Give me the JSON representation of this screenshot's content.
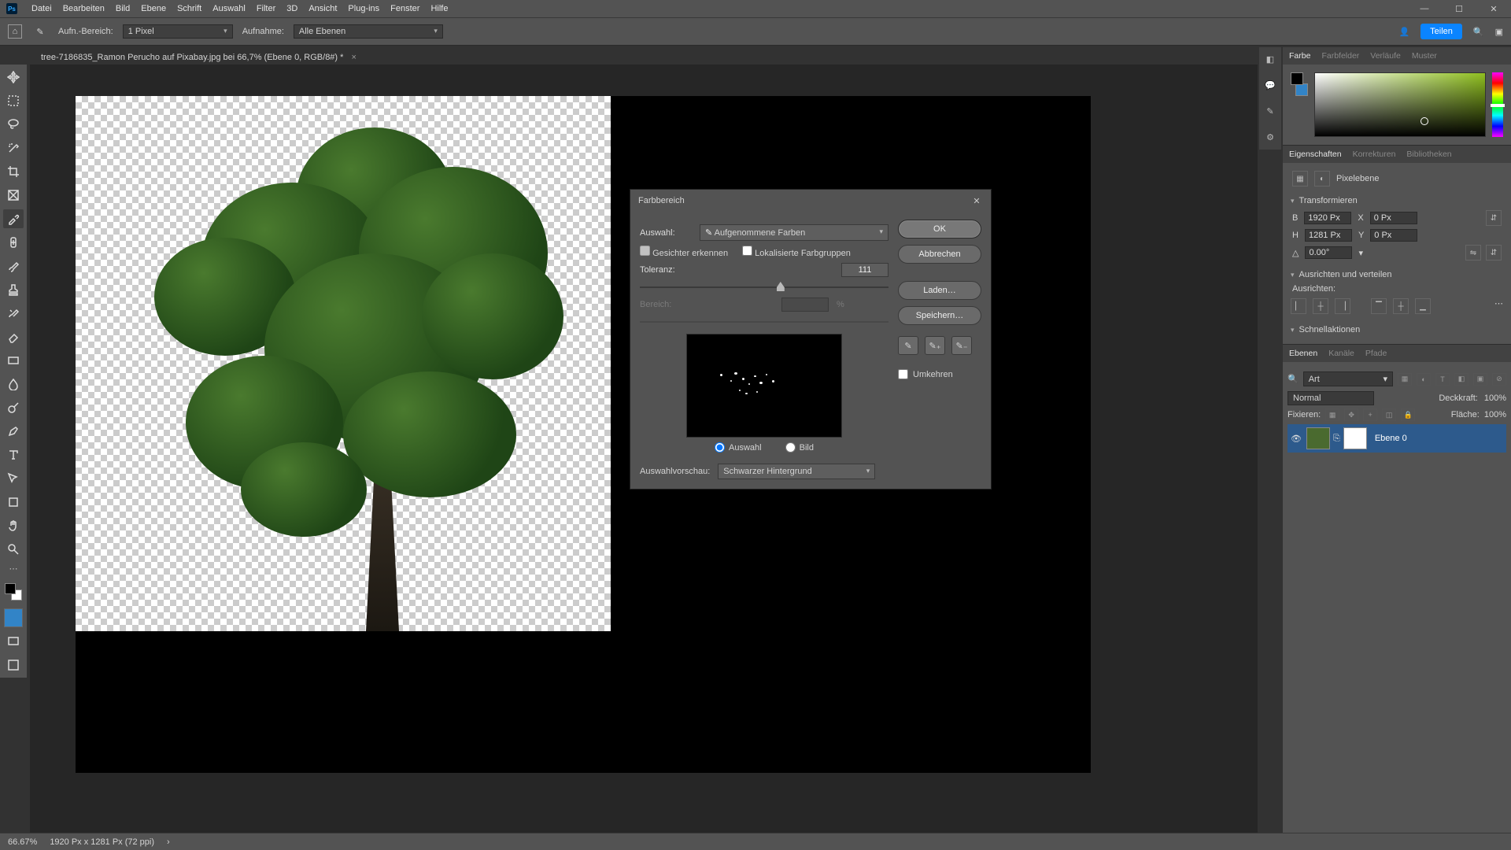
{
  "menu": {
    "items": [
      "Datei",
      "Bearbeiten",
      "Bild",
      "Ebene",
      "Schrift",
      "Auswahl",
      "Filter",
      "3D",
      "Ansicht",
      "Plug-ins",
      "Fenster",
      "Hilfe"
    ]
  },
  "options": {
    "sample_label": "Aufn.-Bereich:",
    "sample_value": "1 Pixel",
    "sample_all_label": "Aufnahme:",
    "sample_all_value": "Alle Ebenen",
    "share": "Teilen"
  },
  "doc_tab": "tree-7186835_Ramon Perucho auf Pixabay.jpg bei 66,7% (Ebene 0, RGB/8#) *",
  "status": {
    "zoom": "66.67%",
    "dims": "1920 Px x 1281 Px (72 ppi)"
  },
  "color_panel": {
    "tabs": [
      "Farbe",
      "Farbfelder",
      "Verläufe",
      "Muster"
    ]
  },
  "props_panel": {
    "tabs": [
      "Eigenschaften",
      "Korrekturen",
      "Bibliotheken"
    ],
    "layer_type": "Pixelebene",
    "sections": {
      "transform": "Transformieren",
      "align": "Ausrichten und verteilen",
      "align_label": "Ausrichten:",
      "quick": "Schnellaktionen"
    },
    "w_label": "B",
    "w": "1920 Px",
    "x_label": "X",
    "x": "0 Px",
    "h_label": "H",
    "h": "1281 Px",
    "y_label": "Y",
    "y": "0 Px",
    "angle": "0.00°"
  },
  "layers_panel": {
    "tabs": [
      "Ebenen",
      "Kanäle",
      "Pfade"
    ],
    "filter_type": "Art",
    "blend": "Normal",
    "opacity_label": "Deckkraft:",
    "opacity": "100%",
    "lock_label": "Fixieren:",
    "fill_label": "Fläche:",
    "fill": "100%",
    "layer_name": "Ebene 0"
  },
  "dialog": {
    "title": "Farbbereich",
    "select_label": "Auswahl:",
    "select_value": "Aufgenommene Farben",
    "detect_faces": "Gesichter erkennen",
    "local_clusters": "Lokalisierte Farbgruppen",
    "tolerance_label": "Toleranz:",
    "tolerance_value": "111",
    "range_label": "Bereich:",
    "range_unit": "%",
    "radio_selection": "Auswahl",
    "radio_image": "Bild",
    "preview_label": "Auswahlvorschau:",
    "preview_value": "Schwarzer Hintergrund",
    "ok": "OK",
    "cancel": "Abbrechen",
    "load": "Laden…",
    "save": "Speichern…",
    "invert": "Umkehren"
  }
}
